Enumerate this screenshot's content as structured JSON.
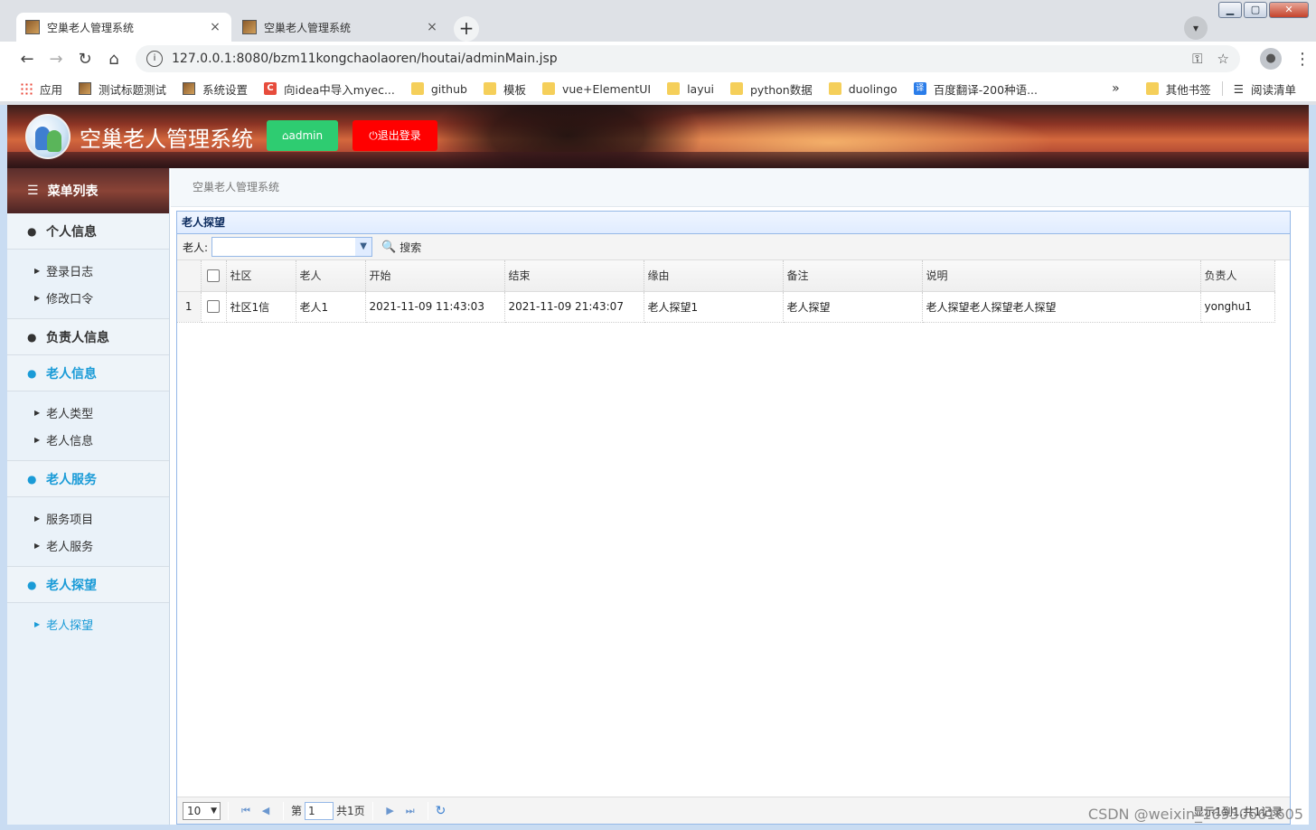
{
  "browser": {
    "tabs": [
      {
        "title": "空巢老人管理系统",
        "close": "×"
      },
      {
        "title": "空巢老人管理系统",
        "close": "×"
      }
    ],
    "new_tab": "+",
    "url": "127.0.0.1:8080/bzm11kongchaolaoren/houtai/adminMain.jsp",
    "bookmarks": [
      {
        "label": "应用",
        "icon": "apps-grid-icon"
      },
      {
        "label": "测试标题测试",
        "icon": "page-image-icon"
      },
      {
        "label": "系统设置",
        "icon": "page-image-icon"
      },
      {
        "label": "向idea中导入myec...",
        "icon": "csdn-icon"
      },
      {
        "label": "github",
        "icon": "folder-icon"
      },
      {
        "label": "模板",
        "icon": "folder-icon"
      },
      {
        "label": "vue+ElementUI",
        "icon": "folder-icon"
      },
      {
        "label": "layui",
        "icon": "folder-icon"
      },
      {
        "label": "python数据",
        "icon": "folder-icon"
      },
      {
        "label": "duolingo",
        "icon": "folder-icon"
      },
      {
        "label": "百度翻译-200种语...",
        "icon": "translate-icon"
      }
    ],
    "bookmarks_more": "»",
    "other_bookmarks": "其他书签",
    "reading_list": "阅读清单"
  },
  "app": {
    "title": "空巢老人管理系统",
    "admin_button": "admin",
    "logout_button": "退出登录",
    "menu_title": "菜单列表",
    "breadcrumb": "空巢老人管理系统"
  },
  "sidebar": {
    "groups": [
      {
        "label": "个人信息",
        "items": [
          "登录日志",
          "修改口令"
        ]
      },
      {
        "label": "负责人信息",
        "items": []
      },
      {
        "label": "老人信息",
        "items": [
          "老人类型",
          "老人信息"
        ]
      },
      {
        "label": "老人服务",
        "items": [
          "服务项目",
          "老人服务"
        ]
      },
      {
        "label": "老人探望",
        "items": [
          "老人探望"
        ]
      }
    ]
  },
  "panel": {
    "title": "老人探望",
    "filter_label": "老人:",
    "filter_value": "",
    "search_button": "搜索"
  },
  "grid": {
    "columns": [
      "社区",
      "老人",
      "开始",
      "结束",
      "缘由",
      "备注",
      "说明",
      "负责人"
    ],
    "rows": [
      {
        "num": "1",
        "cells": [
          "社区1信",
          "老人1",
          "2021-11-09 11:43:03",
          "2021-11-09 21:43:07",
          "老人探望1",
          "老人探望",
          "老人探望老人探望老人探望",
          "yonghu1"
        ]
      }
    ]
  },
  "pager": {
    "page_size": "10",
    "page_prefix": "第",
    "page_value": "1",
    "page_total": "共1页",
    "info": "显示1到1,共1记录"
  },
  "watermark": "CSDN @weixin_16950661605"
}
